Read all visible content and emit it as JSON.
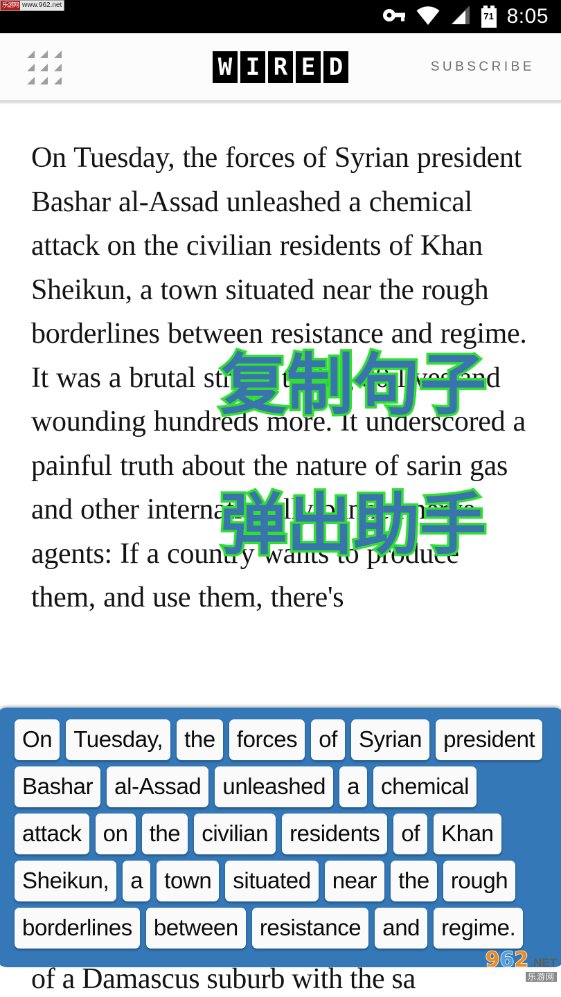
{
  "watermark": {
    "top_cn": "乐游网",
    "top_url": "www.962.net",
    "logo_9": "9",
    "logo_6": "6",
    "logo_2": "2",
    "logo_net": ".NET",
    "logo_cn": "乐游网"
  },
  "statusbar": {
    "time": "8:05",
    "battery_level": "71",
    "icons": [
      "vpn-key-icon",
      "wifi-icon",
      "cell-signal-icon",
      "battery-icon"
    ]
  },
  "appbar": {
    "menu_icon": "grid-menu-icon",
    "logo_letters": [
      "W",
      "I",
      "R",
      "E",
      "D"
    ],
    "subscribe_label": "SUBSCRIBE"
  },
  "article": {
    "paragraph": "On Tuesday, the forces of Syrian president Bashar al-Assad unleashed a chemical attack on the civilian residents of Khan Sheikun, a town situated near the rough borderlines between resistance and regime. It was a brutal strike, taking 80 lives and wounding hundreds more. It underscored a painful truth about the nature of sarin gas and other internationally banned nerve agents: If a country wants to produce them, and use them, there's",
    "tail_line": "of a Damascus suburb with the sa"
  },
  "overlays": {
    "copy_sentence": "复制句子",
    "popup_assistant": "弹出助手",
    "fill_color": "#3a74ad",
    "stroke_color": "#30e030"
  },
  "assistant_panel": {
    "background_color": "#3478b8",
    "chip_rows": [
      [
        "On",
        "Tuesday,",
        "the",
        "forces",
        "of",
        "Syrian",
        "president"
      ],
      [
        "Bashar",
        "al-Assad",
        "unleashed",
        "a",
        "chemical"
      ],
      [
        "attack",
        "on",
        "the",
        "civilian",
        "residents",
        "of",
        "Khan"
      ],
      [
        "Sheikun,",
        "a",
        "town",
        "situated",
        "near",
        "the",
        "rough"
      ],
      [
        "borderlines",
        "between",
        "resistance",
        "and",
        "regime."
      ]
    ]
  }
}
